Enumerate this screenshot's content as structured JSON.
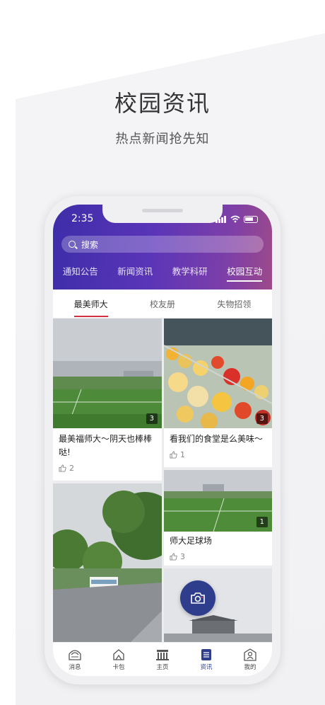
{
  "promo": {
    "title": "校园资讯",
    "subtitle": "热点新闻抢先知"
  },
  "status_bar": {
    "time": "2:35"
  },
  "search": {
    "placeholder": "搜索"
  },
  "top_tabs": [
    {
      "label": "通知公告",
      "active": false
    },
    {
      "label": "新闻资讯",
      "active": false
    },
    {
      "label": "教学科研",
      "active": false
    },
    {
      "label": "校园互动",
      "active": true
    }
  ],
  "sub_tabs": [
    {
      "label": "最美师大",
      "active": true
    },
    {
      "label": "校友册",
      "active": false
    },
    {
      "label": "失物招领",
      "active": false
    }
  ],
  "posts": [
    {
      "title": "最美福师大～阴天也棒棒哒!",
      "photo_count": "3",
      "likes": "2"
    },
    {
      "title": "看我们的食堂是么美味～",
      "photo_count": "3",
      "likes": "1"
    },
    {
      "title": "师大足球场",
      "photo_count": "1",
      "likes": "3"
    }
  ],
  "bottom_nav": [
    {
      "label": "消息",
      "icon": "message-icon",
      "active": false
    },
    {
      "label": "卡包",
      "icon": "card-wallet-icon",
      "active": false
    },
    {
      "label": "主页",
      "icon": "home-building-icon",
      "active": false
    },
    {
      "label": "资讯",
      "icon": "news-icon",
      "active": true
    },
    {
      "label": "我的",
      "icon": "profile-icon",
      "active": false
    }
  ],
  "colors": {
    "header_start": "#3d2da8",
    "header_end": "#9c4a8a",
    "accent_red": "#d23040",
    "accent_navy": "#2e3e8c"
  },
  "fab": {
    "icon": "camera-icon"
  }
}
